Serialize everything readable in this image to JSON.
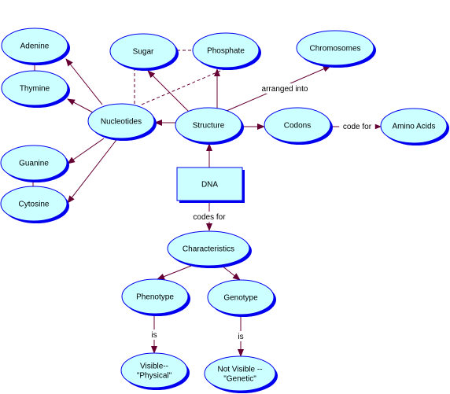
{
  "colors": {
    "node_fill": "#ccffff",
    "node_border": "#0000ee",
    "node_shadow": "#0000ee",
    "link": "#660033"
  },
  "nodes": [
    {
      "id": "adenine",
      "label": [
        "Adenine"
      ],
      "shape": "ellipse"
    },
    {
      "id": "thymine",
      "label": [
        "Thymine"
      ],
      "shape": "ellipse"
    },
    {
      "id": "sugar",
      "label": [
        "Sugar"
      ],
      "shape": "ellipse"
    },
    {
      "id": "phosphate",
      "label": [
        "Phosphate"
      ],
      "shape": "ellipse"
    },
    {
      "id": "chromosomes",
      "label": [
        "Chromosomes"
      ],
      "shape": "ellipse"
    },
    {
      "id": "nucleotides",
      "label": [
        "Nucleotides"
      ],
      "shape": "ellipse"
    },
    {
      "id": "structure",
      "label": [
        "Structure"
      ],
      "shape": "ellipse"
    },
    {
      "id": "codons",
      "label": [
        "Codons"
      ],
      "shape": "ellipse"
    },
    {
      "id": "amino-acids",
      "label": [
        "Amino Acids"
      ],
      "shape": "ellipse"
    },
    {
      "id": "guanine",
      "label": [
        "Guanine"
      ],
      "shape": "ellipse"
    },
    {
      "id": "cytosine",
      "label": [
        "Cytosine"
      ],
      "shape": "ellipse"
    },
    {
      "id": "dna",
      "label": [
        "DNA"
      ],
      "shape": "rect"
    },
    {
      "id": "characteristics",
      "label": [
        "Characteristics"
      ],
      "shape": "ellipse"
    },
    {
      "id": "phenotype",
      "label": [
        "Phenotype"
      ],
      "shape": "ellipse"
    },
    {
      "id": "genotype",
      "label": [
        "Genotype"
      ],
      "shape": "ellipse"
    },
    {
      "id": "visible",
      "label": [
        "Visible--",
        "\"Physical\""
      ],
      "shape": "ellipse"
    },
    {
      "id": "not-visible",
      "label": [
        "Not Visible --",
        "\"Genetic\""
      ],
      "shape": "ellipse"
    }
  ],
  "links": [
    {
      "from": "dna",
      "to": "structure",
      "label": "",
      "style": "solid",
      "arrow": true
    },
    {
      "from": "dna",
      "to": "characteristics",
      "label": "codes for",
      "style": "solid",
      "arrow": true
    },
    {
      "from": "structure",
      "to": "nucleotides",
      "label": "",
      "style": "solid",
      "arrow": true
    },
    {
      "from": "structure",
      "to": "sugar",
      "label": "",
      "style": "solid",
      "arrow": true
    },
    {
      "from": "structure",
      "to": "phosphate",
      "label": "",
      "style": "solid",
      "arrow": true
    },
    {
      "from": "structure",
      "to": "chromosomes",
      "label": "arranged into",
      "style": "solid",
      "arrow": true
    },
    {
      "from": "structure",
      "to": "codons",
      "label": "",
      "style": "solid",
      "arrow": true
    },
    {
      "from": "codons",
      "to": "amino-acids",
      "label": "code for",
      "style": "solid",
      "arrow": true
    },
    {
      "from": "nucleotides",
      "to": "adenine",
      "label": "",
      "style": "solid",
      "arrow": true
    },
    {
      "from": "nucleotides",
      "to": "thymine",
      "label": "",
      "style": "solid",
      "arrow": true
    },
    {
      "from": "nucleotides",
      "to": "guanine",
      "label": "",
      "style": "solid",
      "arrow": true
    },
    {
      "from": "nucleotides",
      "to": "cytosine",
      "label": "",
      "style": "solid",
      "arrow": true
    },
    {
      "from": "adenine",
      "to": "thymine",
      "label": "",
      "style": "solid",
      "arrow": false
    },
    {
      "from": "guanine",
      "to": "cytosine",
      "label": "",
      "style": "solid",
      "arrow": false
    },
    {
      "from": "sugar",
      "to": "phosphate",
      "label": "",
      "style": "dashed",
      "arrow": false
    },
    {
      "from": "nucleotides",
      "to": "sugar",
      "label": "",
      "style": "dashed",
      "arrow": false
    },
    {
      "from": "nucleotides",
      "to": "phosphate",
      "label": "",
      "style": "dashed",
      "arrow": false
    },
    {
      "from": "characteristics",
      "to": "phenotype",
      "label": "",
      "style": "solid",
      "arrow": true
    },
    {
      "from": "characteristics",
      "to": "genotype",
      "label": "",
      "style": "solid",
      "arrow": true
    },
    {
      "from": "phenotype",
      "to": "visible",
      "label": "is",
      "style": "solid",
      "arrow": true
    },
    {
      "from": "genotype",
      "to": "not-visible",
      "label": "is",
      "style": "solid",
      "arrow": true
    }
  ]
}
